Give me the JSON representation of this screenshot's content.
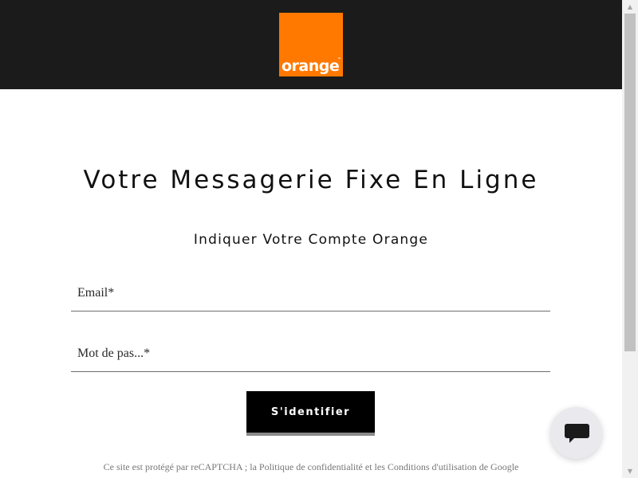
{
  "header": {
    "logo_text": "orange",
    "logo_tm": "™",
    "logo_color": "#ff7900",
    "background": "#1b1b1b"
  },
  "main": {
    "title": "Votre Messagerie Fixe En Ligne",
    "subtitle": "Indiquer Votre Compte Orange"
  },
  "form": {
    "email_placeholder": "Email*",
    "email_value": "",
    "password_placeholder": "Mot de pas...*",
    "password_value": "",
    "submit_label": "S'identifier"
  },
  "footer": {
    "recaptcha_note": "Ce site est protégé par reCAPTCHA ; la Politique de confidentialité et les Conditions d'utilisation de Google"
  },
  "chat": {
    "icon": "chat-bubble-icon"
  },
  "scrollbar": {
    "up_icon": "▲",
    "down_icon": "▼"
  }
}
